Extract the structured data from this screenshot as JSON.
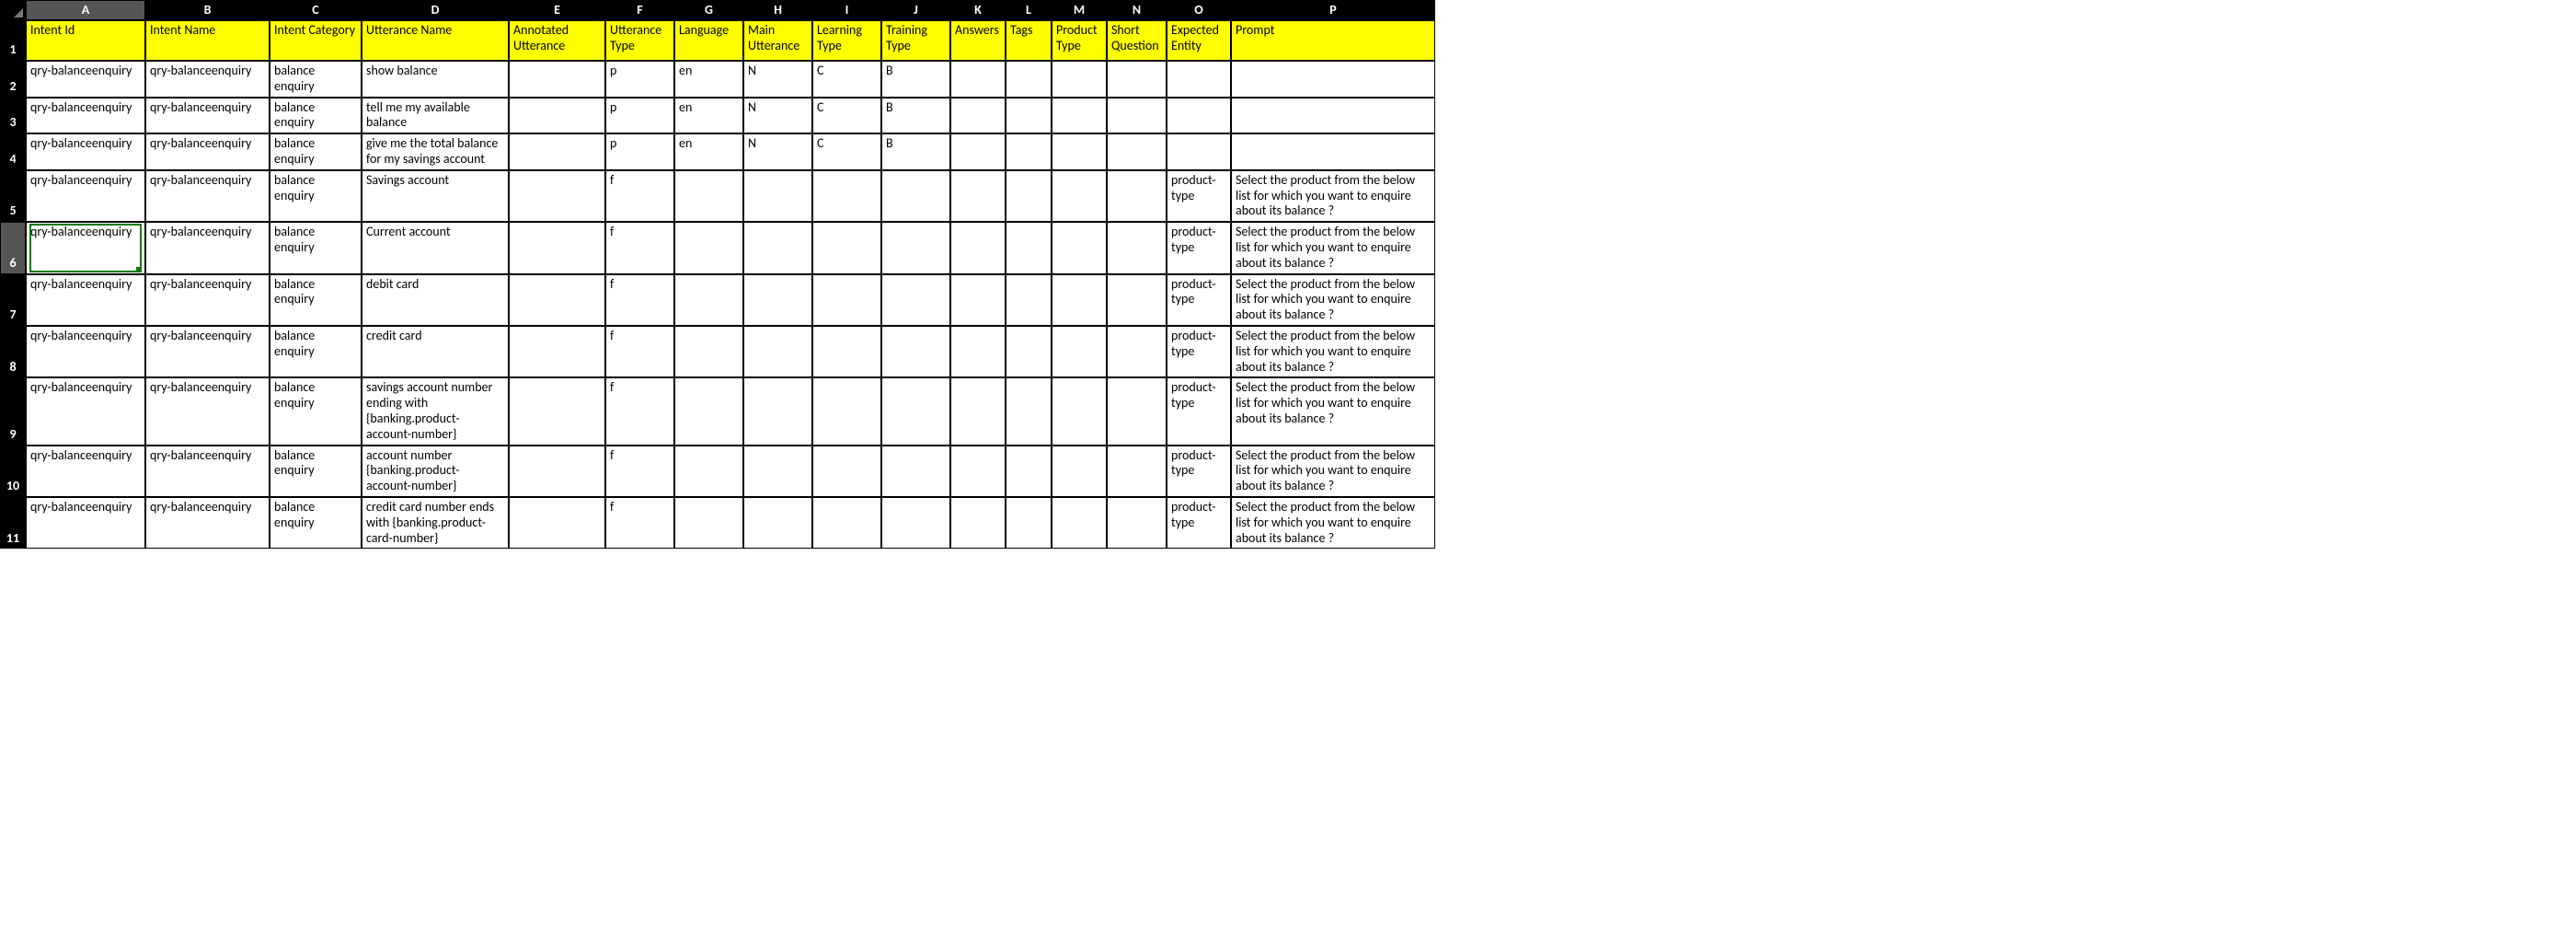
{
  "columns": [
    "A",
    "B",
    "C",
    "D",
    "E",
    "F",
    "G",
    "H",
    "I",
    "J",
    "K",
    "L",
    "M",
    "N",
    "O",
    "P"
  ],
  "headers": {
    "A": "Intent Id",
    "B": "Intent Name",
    "C": "Intent Category",
    "D": "Utterance Name",
    "E": "Annotated Utterance",
    "F": "Utterance Type",
    "G": "Language",
    "H": "Main Utterance",
    "I": "Learning Type",
    "J": "Training Type",
    "K": "Answers",
    "L": "Tags",
    "M": "Product Type",
    "N": "Short Question",
    "O": "Expected Entity",
    "P": "Prompt"
  },
  "active_cell": "A6",
  "rows": [
    {
      "n": "2",
      "A": "qry-balanceenquiry",
      "B": "qry-balanceenquiry",
      "C": "balance enquiry",
      "D": "show balance",
      "E": "",
      "F": "p",
      "G": "en",
      "H": "N",
      "I": "C",
      "J": "B",
      "K": "",
      "L": "",
      "M": "",
      "N": "",
      "O": "",
      "P": ""
    },
    {
      "n": "3",
      "A": "qry-balanceenquiry",
      "B": "qry-balanceenquiry",
      "C": "balance enquiry",
      "D": "tell me my available balance",
      "E": "",
      "F": "p",
      "G": "en",
      "H": "N",
      "I": "C",
      "J": "B",
      "K": "",
      "L": "",
      "M": "",
      "N": "",
      "O": "",
      "P": ""
    },
    {
      "n": "4",
      "A": "qry-balanceenquiry",
      "B": "qry-balanceenquiry",
      "C": "balance enquiry",
      "D": "give me the total balance for my savings account",
      "E": "",
      "F": "p",
      "G": "en",
      "H": "N",
      "I": "C",
      "J": "B",
      "K": "",
      "L": "",
      "M": "",
      "N": "",
      "O": "",
      "P": ""
    },
    {
      "n": "5",
      "A": "qry-balanceenquiry",
      "B": "qry-balanceenquiry",
      "C": "balance enquiry",
      "D": "Savings account",
      "E": "",
      "F": "f",
      "G": "",
      "H": "",
      "I": "",
      "J": "",
      "K": "",
      "L": "",
      "M": "",
      "N": "",
      "O": "product-type",
      "P": "Select the product from the below list for which you want to enquire about its balance ?"
    },
    {
      "n": "6",
      "A": "qry-balanceenquiry",
      "B": "qry-balanceenquiry",
      "C": "balance enquiry",
      "D": "Current account",
      "E": "",
      "F": "f",
      "G": "",
      "H": "",
      "I": "",
      "J": "",
      "K": "",
      "L": "",
      "M": "",
      "N": "",
      "O": "product-type",
      "P": "Select the product from the below list for which you want to enquire about its balance ?"
    },
    {
      "n": "7",
      "A": "qry-balanceenquiry",
      "B": "qry-balanceenquiry",
      "C": "balance enquiry",
      "D": "debit card",
      "E": "",
      "F": "f",
      "G": "",
      "H": "",
      "I": "",
      "J": "",
      "K": "",
      "L": "",
      "M": "",
      "N": "",
      "O": "product-type",
      "P": "Select the product from the below list for which you want to enquire about its balance ?"
    },
    {
      "n": "8",
      "A": "qry-balanceenquiry",
      "B": "qry-balanceenquiry",
      "C": "balance enquiry",
      "D": "credit card",
      "E": "",
      "F": "f",
      "G": "",
      "H": "",
      "I": "",
      "J": "",
      "K": "",
      "L": "",
      "M": "",
      "N": "",
      "O": "product-type",
      "P": "Select the product from the below list for which you want to enquire about its balance ?"
    },
    {
      "n": "9",
      "A": "qry-balanceenquiry",
      "B": "qry-balanceenquiry",
      "C": "balance enquiry",
      "D": "savings account number ending with {banking.product-account-number}",
      "E": "",
      "F": "f",
      "G": "",
      "H": "",
      "I": "",
      "J": "",
      "K": "",
      "L": "",
      "M": "",
      "N": "",
      "O": "product-type",
      "P": "Select the product from the below list for which you want to enquire about its balance ?"
    },
    {
      "n": "10",
      "A": "qry-balanceenquiry",
      "B": "qry-balanceenquiry",
      "C": "balance enquiry",
      "D": "account number {banking.product-account-number}",
      "E": "",
      "F": "f",
      "G": "",
      "H": "",
      "I": "",
      "J": "",
      "K": "",
      "L": "",
      "M": "",
      "N": "",
      "O": "product-type",
      "P": "Select the product from the below list for which you want to enquire about its balance ?"
    },
    {
      "n": "11",
      "A": "qry-balanceenquiry",
      "B": "qry-balanceenquiry",
      "C": "balance enquiry",
      "D": "credit card number ends with {banking.product-card-number}",
      "E": "",
      "F": "f",
      "G": "",
      "H": "",
      "I": "",
      "J": "",
      "K": "",
      "L": "",
      "M": "",
      "N": "",
      "O": "product-type",
      "P": "Select the product from the below list for which you want to enquire about its balance ?"
    }
  ]
}
